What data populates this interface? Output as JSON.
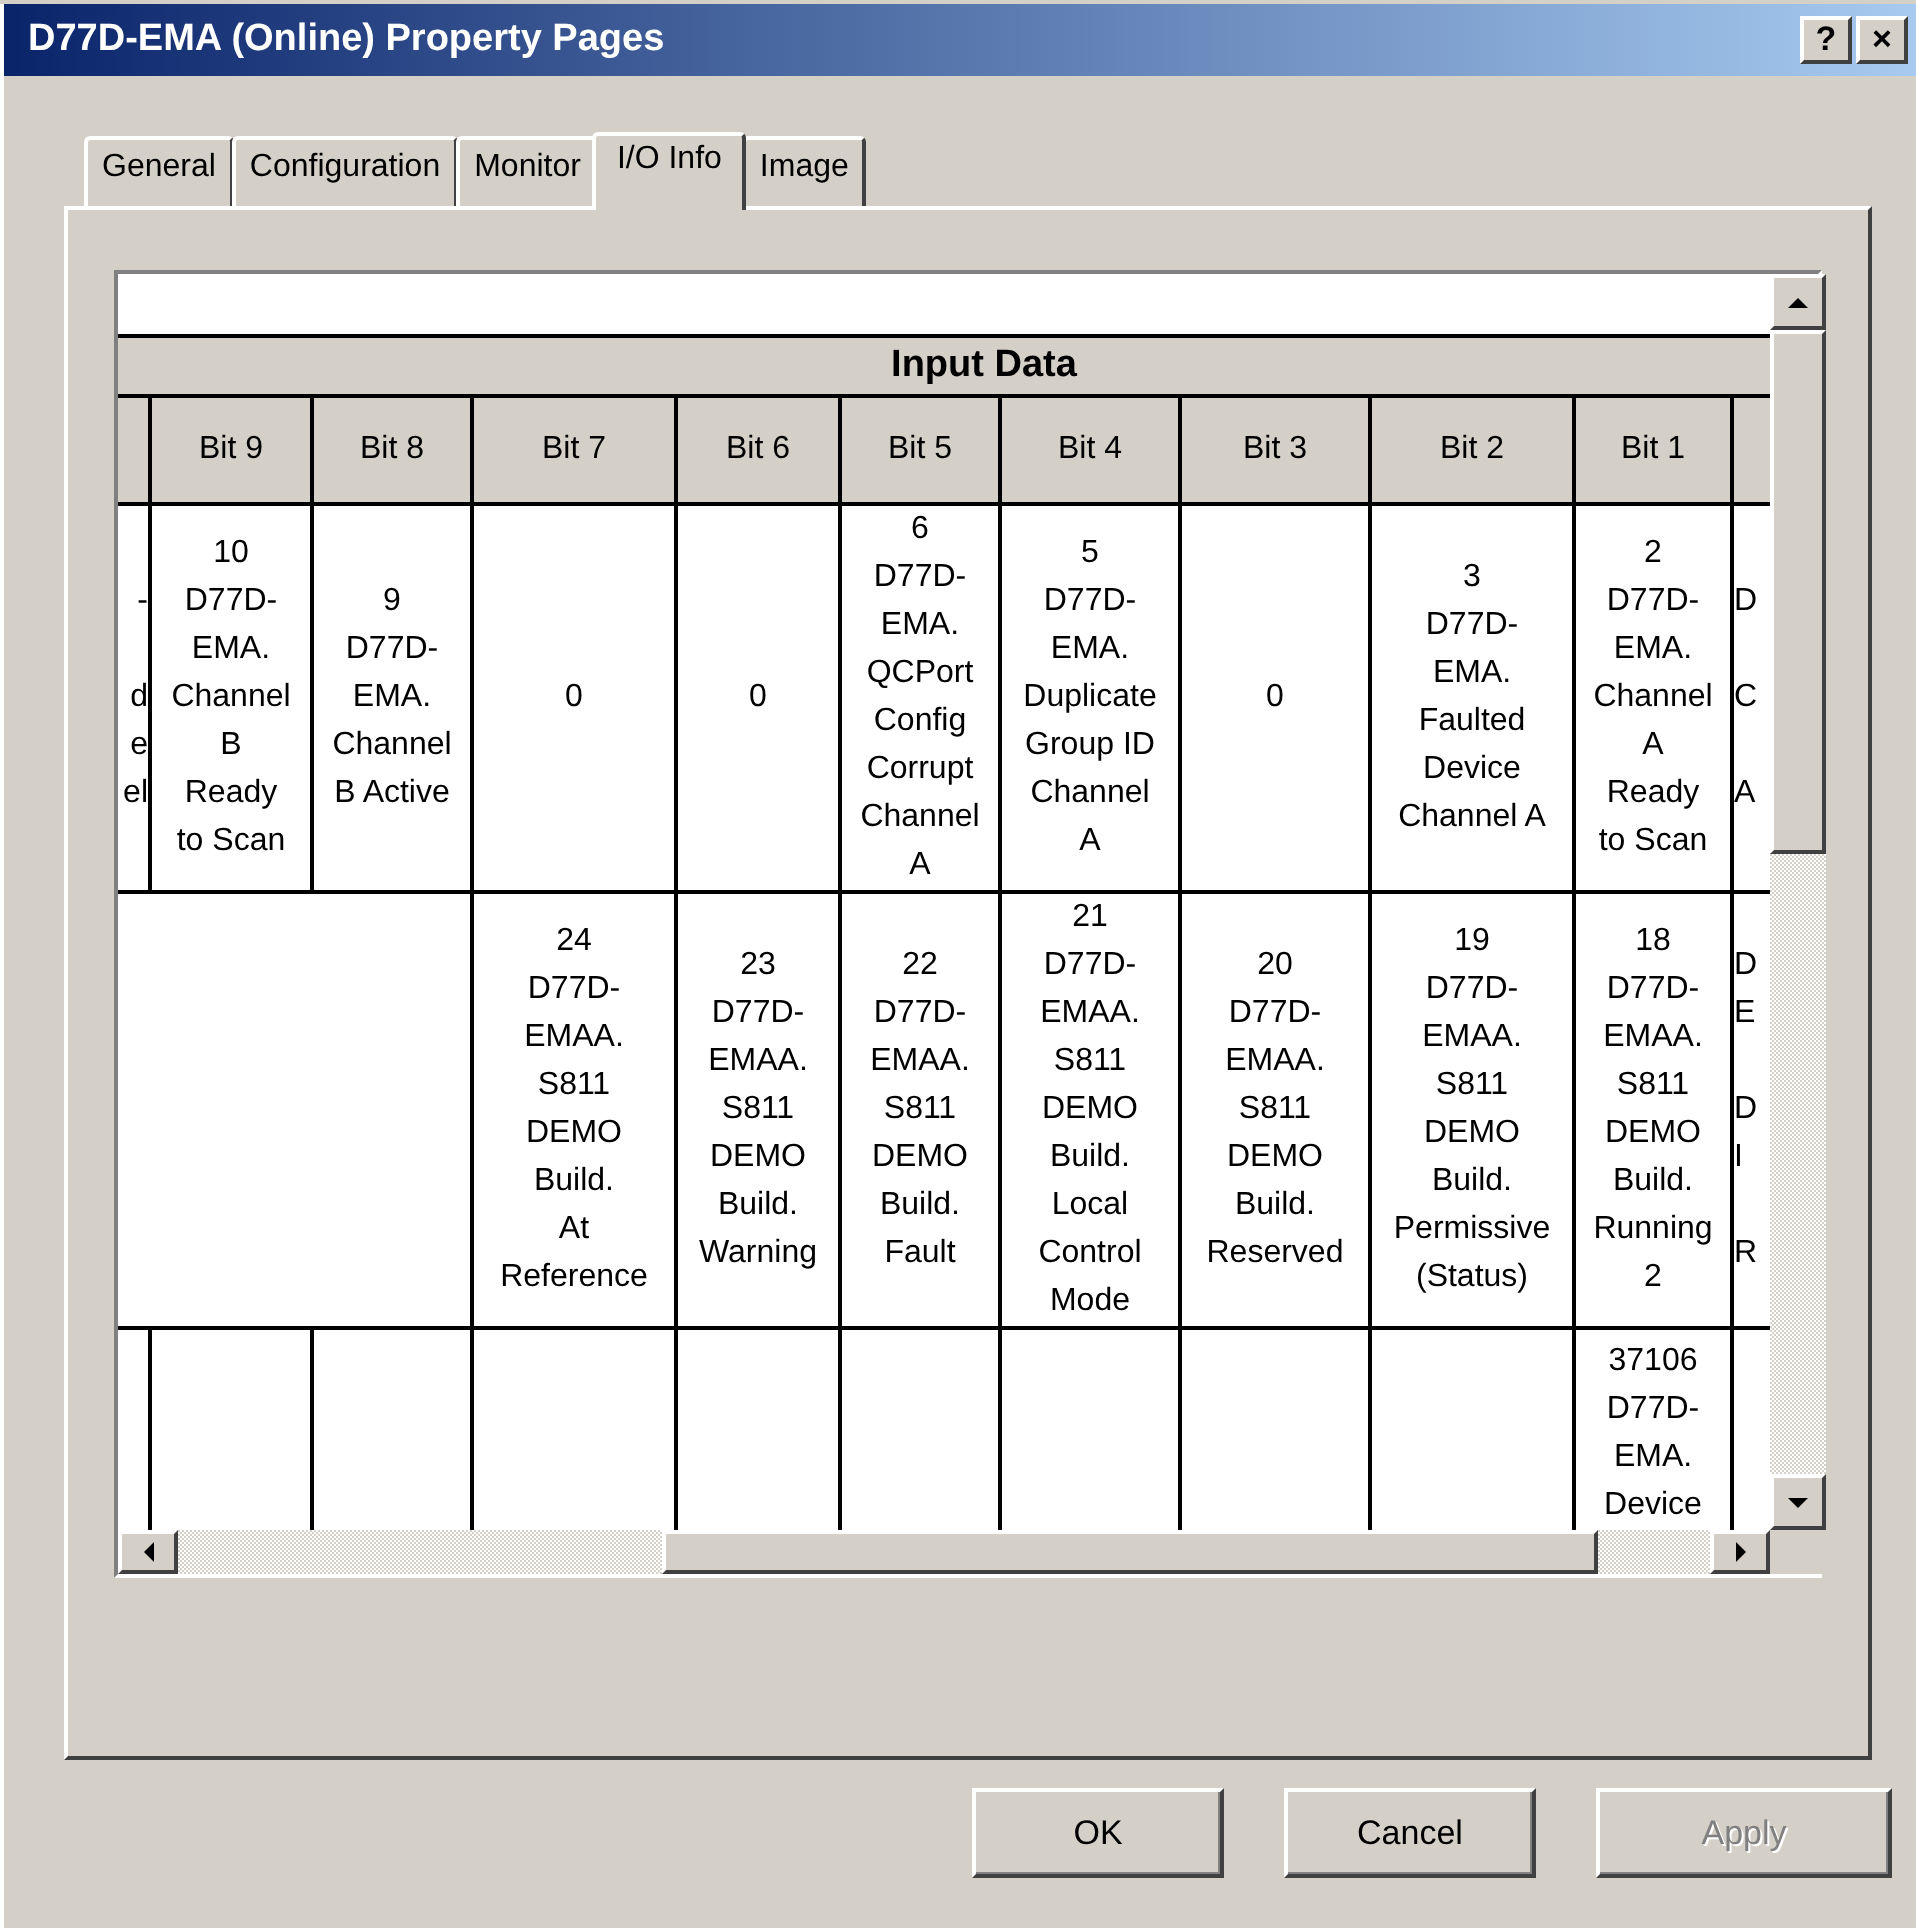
{
  "window": {
    "title": "D77D-EMA (Online) Property Pages",
    "title_buttons": [
      "?",
      "×"
    ]
  },
  "tabs": [
    {
      "label": "General",
      "selected": false
    },
    {
      "label": "Configuration",
      "selected": false
    },
    {
      "label": "Monitor",
      "selected": false
    },
    {
      "label": "I/O Info",
      "selected": true
    },
    {
      "label": "Image",
      "selected": false
    }
  ],
  "table": {
    "group_heading": "Input Data",
    "columns": [
      "Bit 9",
      "Bit 8",
      "Bit 7",
      "Bit 6",
      "Bit 5",
      "Bit 4",
      "Bit 3",
      "Bit 2",
      "Bit 1"
    ],
    "rows": [
      {
        "left_edge": "-\n\nd\ne\nel",
        "right_edge": "D\n\nC\n\nA",
        "cells": [
          {
            "kind": "text",
            "text": "10\nD77D-\nEMA.\nChannel\nB\nReady\nto Scan"
          },
          {
            "kind": "text",
            "text": "9\nD77D-\nEMA.\nChannel\nB Active"
          },
          {
            "kind": "text",
            "text": "0"
          },
          {
            "kind": "text",
            "text": "0"
          },
          {
            "kind": "text",
            "text": "6\nD77D-\nEMA.\nQCPort\nConfig\nCorrupt\nChannel\nA"
          },
          {
            "kind": "text",
            "text": "5\nD77D-\nEMA.\nDuplicate\nGroup ID\nChannel\nA"
          },
          {
            "kind": "text",
            "text": "0"
          },
          {
            "kind": "text",
            "text": "3\nD77D-\nEMA.\nFaulted\nDevice\nChannel A"
          },
          {
            "kind": "text",
            "text": "2\nD77D-\nEMA.\nChannel\nA\nReady\nto Scan"
          }
        ]
      },
      {
        "right_edge": "D\nE\n\nD\nI\n\nR",
        "cells": [
          {
            "kind": "merged"
          },
          {
            "kind": "merged"
          },
          {
            "kind": "text",
            "text": "24\nD77D-\nEMAA.\nS811\nDEMO\nBuild.\nAt\nReference"
          },
          {
            "kind": "text",
            "text": "23\nD77D-\nEMAA.\nS811\nDEMO\nBuild.\nWarning"
          },
          {
            "kind": "text",
            "text": "22\nD77D-\nEMAA.\nS811\nDEMO\nBuild.\nFault"
          },
          {
            "kind": "text",
            "text": "21\nD77D-\nEMAA.\nS811\nDEMO\nBuild.\nLocal\nControl\nMode"
          },
          {
            "kind": "text",
            "text": "20\nD77D-\nEMAA.\nS811\nDEMO\nBuild.\nReserved"
          },
          {
            "kind": "text",
            "text": "19\nD77D-\nEMAA.\nS811\nDEMO\nBuild.\nPermissive\n(Status)"
          },
          {
            "kind": "text",
            "text": "18\nD77D-\nEMAA.\nS811\nDEMO\nBuild.\nRunning\n2"
          }
        ]
      },
      {
        "cells": [
          {
            "kind": "empty"
          },
          {
            "kind": "empty"
          },
          {
            "kind": "empty"
          },
          {
            "kind": "empty"
          },
          {
            "kind": "empty"
          },
          {
            "kind": "empty"
          },
          {
            "kind": "empty"
          },
          {
            "kind": "empty"
          },
          {
            "kind": "text",
            "text": "37106\nD77D-\nEMA.\nDevice"
          }
        ]
      }
    ]
  },
  "buttons": [
    {
      "label": "OK",
      "disabled": false
    },
    {
      "label": "Cancel",
      "disabled": false
    },
    {
      "label": "Apply",
      "disabled": true
    }
  ]
}
